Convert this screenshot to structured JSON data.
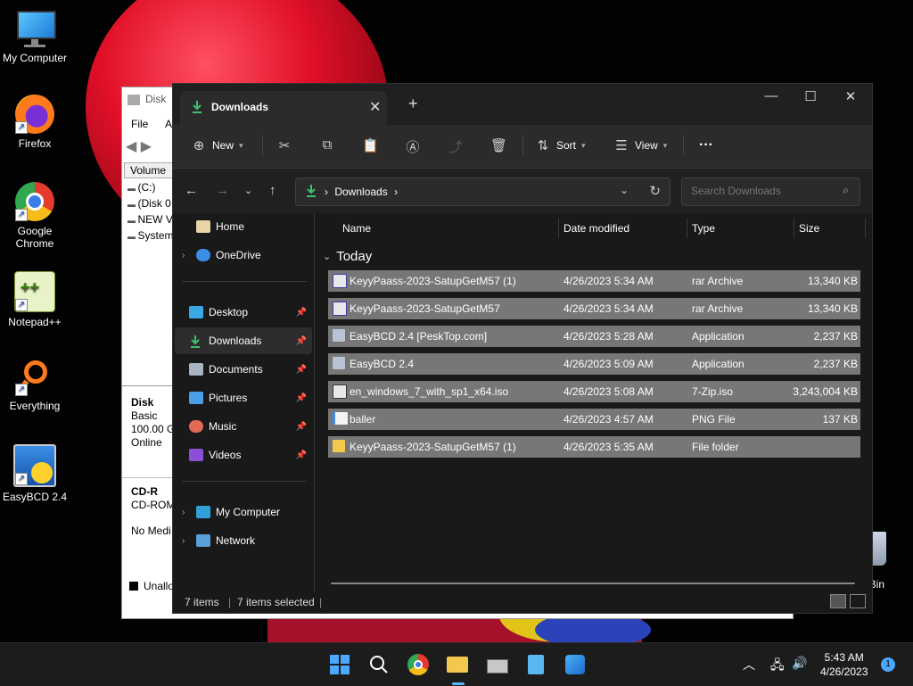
{
  "desktop": {
    "icons": [
      {
        "label": "My Computer"
      },
      {
        "label": "Firefox"
      },
      {
        "label": "Google Chrome"
      },
      {
        "label": "Notepad++"
      },
      {
        "label": "Everything"
      },
      {
        "label": "EasyBCD 2.4"
      }
    ],
    "recycle_label": "le Bin"
  },
  "disk_mgmt": {
    "title": "Disk",
    "menu": [
      "File",
      "Ac"
    ],
    "volume_header": "Volume",
    "volumes": [
      "(C:)",
      "(Disk 0",
      "NEW V",
      "System"
    ],
    "disk": {
      "name": "Disk",
      "type": "Basic",
      "size": "100.00 G",
      "state": "Online"
    },
    "cd": {
      "name": "CD-R",
      "type": "CD-ROM",
      "media": "No Medi"
    },
    "unalloc": "Unallo"
  },
  "explorer": {
    "tab_title": "Downloads",
    "toolbar": {
      "new_label": "New",
      "sort_label": "Sort",
      "view_label": "View",
      "more_label": "···"
    },
    "address": {
      "path": "Downloads",
      "separator": "›"
    },
    "search": {
      "placeholder": "Search Downloads"
    },
    "nav": {
      "home": "Home",
      "onedrive": "OneDrive",
      "desktop": "Desktop",
      "downloads": "Downloads",
      "documents": "Documents",
      "pictures": "Pictures",
      "music": "Music",
      "videos": "Videos",
      "mycomputer": "My Computer",
      "network": "Network"
    },
    "columns": {
      "name": "Name",
      "date": "Date modified",
      "type": "Type",
      "size": "Size"
    },
    "group_label": "Today",
    "files": [
      {
        "name": "KeyyPaass-2023-SatupGetM57 (1)",
        "date": "4/26/2023 5:34 AM",
        "type": "rar Archive",
        "size": "13,340 KB"
      },
      {
        "name": "KeyyPaass-2023-SatupGetM57",
        "date": "4/26/2023 5:34 AM",
        "type": "rar Archive",
        "size": "13,340 KB"
      },
      {
        "name": "EasyBCD 2.4 [PeskTop.com]",
        "date": "4/26/2023 5:28 AM",
        "type": "Application",
        "size": "2,237 KB"
      },
      {
        "name": "EasyBCD 2.4",
        "date": "4/26/2023 5:09 AM",
        "type": "Application",
        "size": "2,237 KB"
      },
      {
        "name": "en_windows_7_with_sp1_x64.iso",
        "date": "4/26/2023 5:08 AM",
        "type": "7-Zip.iso",
        "size": "3,243,004 KB"
      },
      {
        "name": "baller",
        "date": "4/26/2023 4:57 AM",
        "type": "PNG File",
        "size": "137 KB"
      },
      {
        "name": "KeyyPaass-2023-SatupGetM57 (1)",
        "date": "4/26/2023 5:35 AM",
        "type": "File folder",
        "size": ""
      }
    ],
    "status": {
      "items": "7 items",
      "selected": "7 items selected"
    }
  },
  "taskbar": {
    "time": "5:43 AM",
    "date": "4/26/2023",
    "notifications": "1"
  },
  "colors": {
    "explorer_bg": "#191919",
    "selection": "#777777",
    "accent": "#4aa8ff",
    "downloads_green": "#3fbf6f"
  }
}
